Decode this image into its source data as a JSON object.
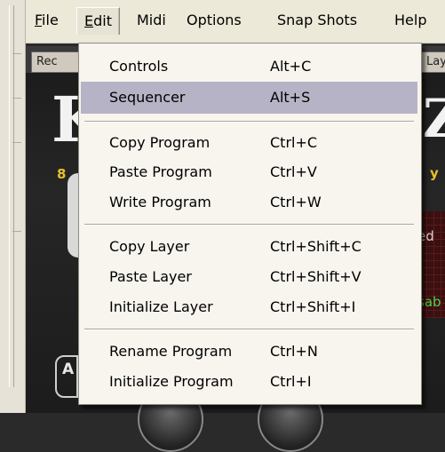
{
  "menubar": {
    "items": [
      {
        "label": "File",
        "mnemonic": "F",
        "rest": "ile"
      },
      {
        "label": "Edit",
        "mnemonic": "E",
        "rest": "dit"
      },
      {
        "label": "Midi"
      },
      {
        "label": "Options"
      },
      {
        "label": "Snap Shots"
      },
      {
        "label": "Help"
      }
    ]
  },
  "background": {
    "tab_left": "Rec",
    "tab_right": "Lay",
    "logo_left": "K",
    "logo_right": "Z",
    "num_left": "8",
    "num_right": "y",
    "text_red": "ed",
    "text_green": "sab",
    "panel_letter": "A"
  },
  "edit_menu": {
    "selected_index": 1,
    "groups": [
      [
        {
          "label": "Controls",
          "shortcut": "Alt+C"
        },
        {
          "label": "Sequencer",
          "shortcut": "Alt+S"
        }
      ],
      [
        {
          "label": "Copy Program",
          "shortcut": "Ctrl+C"
        },
        {
          "label": "Paste Program",
          "shortcut": "Ctrl+V"
        },
        {
          "label": "Write Program",
          "shortcut": "Ctrl+W"
        }
      ],
      [
        {
          "label": "Copy Layer",
          "shortcut": "Ctrl+Shift+C"
        },
        {
          "label": "Paste Layer",
          "shortcut": "Ctrl+Shift+V"
        },
        {
          "label": "Initialize Layer",
          "shortcut": "Ctrl+Shift+I"
        }
      ],
      [
        {
          "label": "Rename Program",
          "shortcut": "Ctrl+N"
        },
        {
          "label": "Initialize Program",
          "shortcut": "Ctrl+I"
        }
      ]
    ]
  },
  "colors": {
    "menu_bg": "#f7f5ee",
    "menubar_bg": "#ece9d8",
    "selection": "#b6b3c6",
    "accent_yellow": "#e6c12a",
    "accent_green": "#4fd04f"
  }
}
